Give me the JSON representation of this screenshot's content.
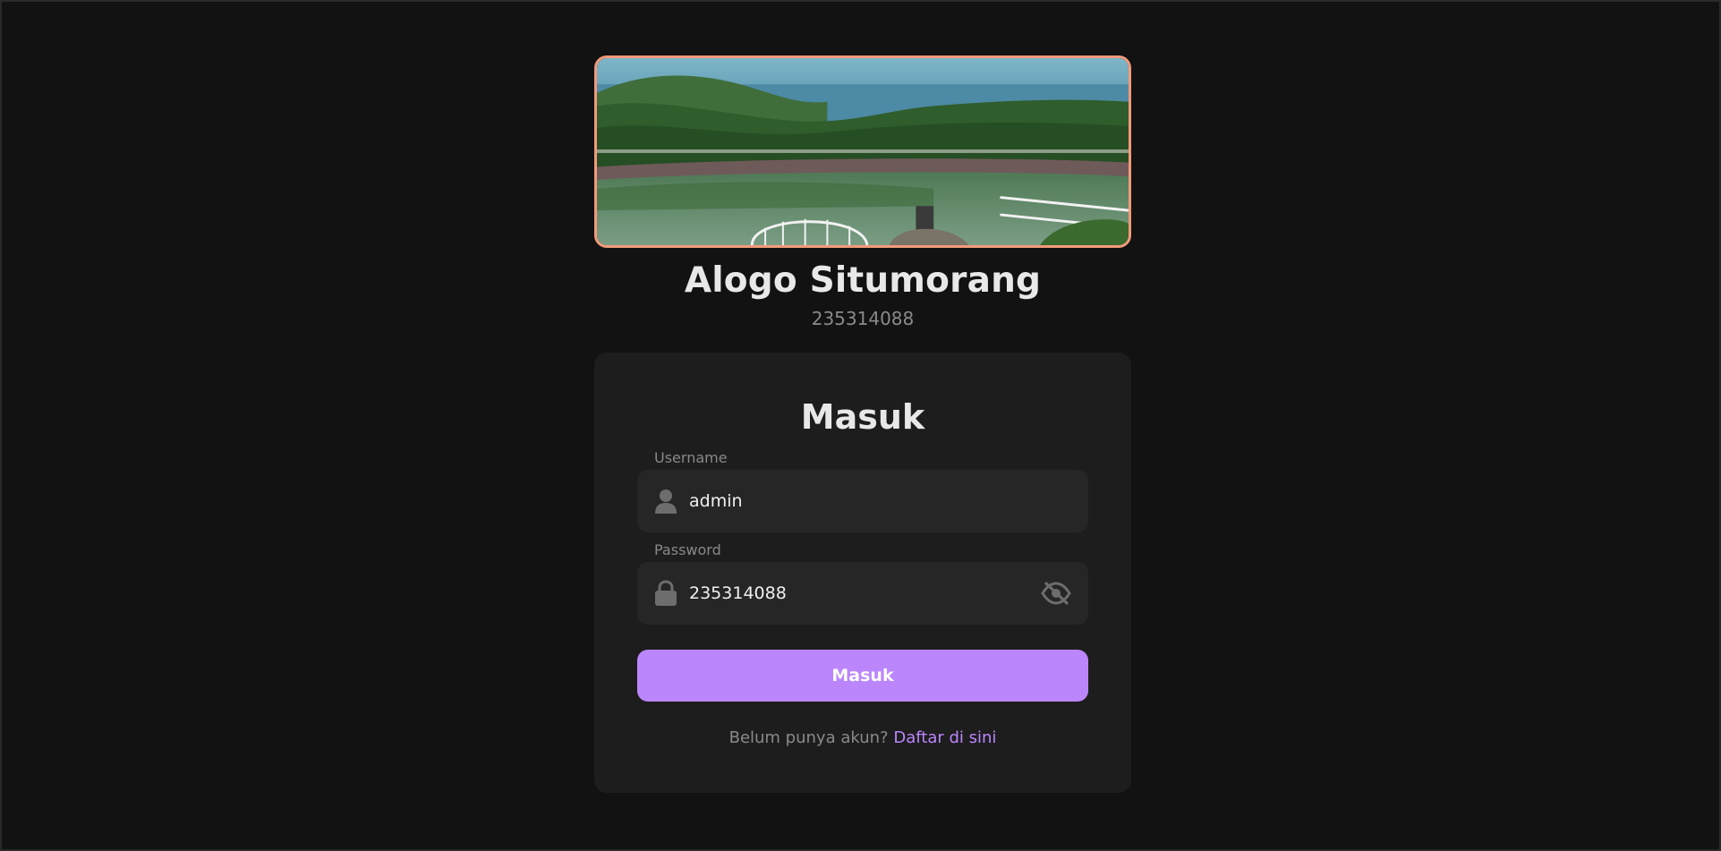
{
  "profile": {
    "name": "Alogo Situmorang",
    "id": "235314088",
    "banner_image": "landscape-reservoir-photo"
  },
  "login_card": {
    "title": "Masuk",
    "username": {
      "label": "Username",
      "value": "admin",
      "icon": "user-icon"
    },
    "password": {
      "label": "Password",
      "value": "235314088",
      "icon": "lock-icon",
      "toggle_icon": "eye-slash-icon"
    },
    "submit_label": "Masuk",
    "register_prompt": "Belum punya akun?",
    "register_link": "Daftar di sini"
  },
  "colors": {
    "background": "#121212",
    "card": "#1d1d1d",
    "field": "#262626",
    "accent": "#bb86fc",
    "banner_border": "#f29a7a"
  }
}
